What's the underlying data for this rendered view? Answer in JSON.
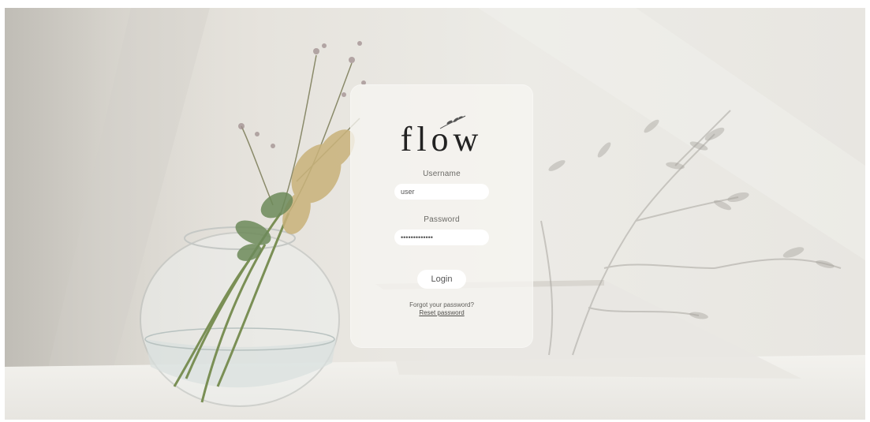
{
  "brand": {
    "logo_text": "flow"
  },
  "login_form": {
    "username_label": "Username",
    "username_value": "user",
    "password_label": "Password",
    "password_value": "•••••••••••••",
    "login_button": "Login",
    "forgot_text": "Forgot your password?",
    "reset_link": "Reset password"
  },
  "colors": {
    "card_background": "#f6f5f1",
    "input_background": "#ffffff",
    "text": "#6b6a66"
  }
}
